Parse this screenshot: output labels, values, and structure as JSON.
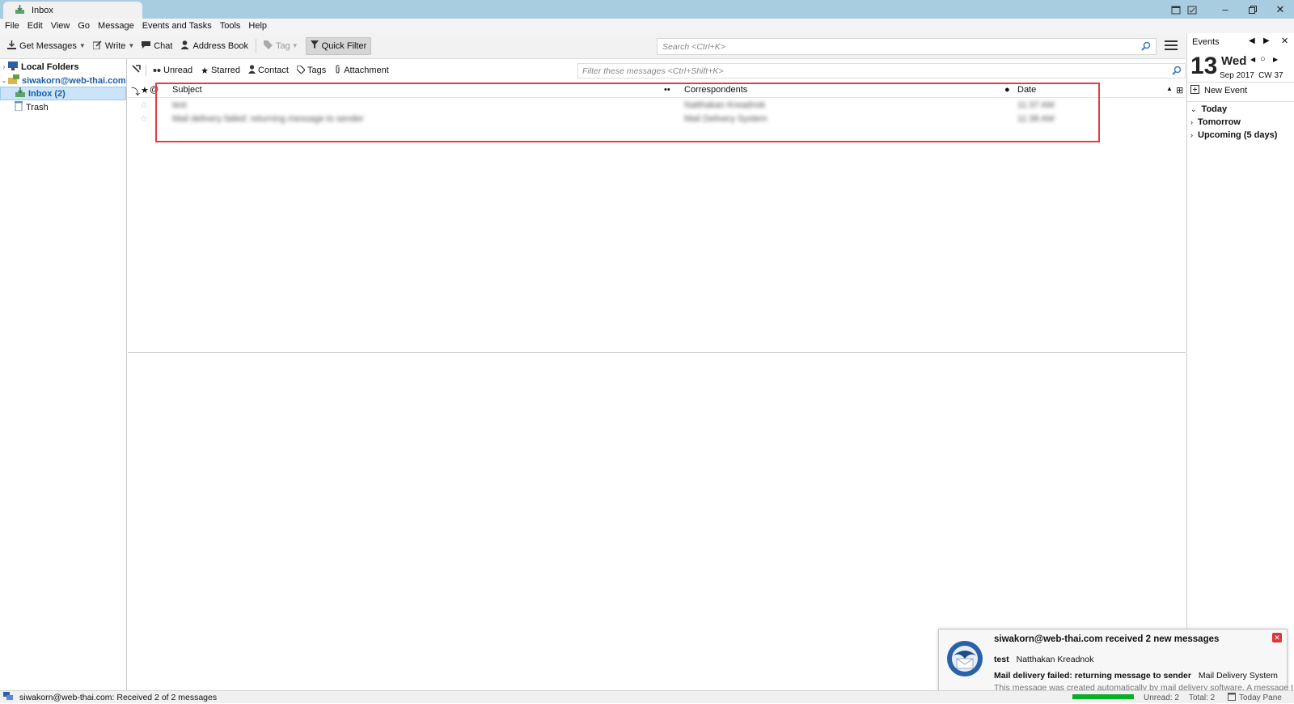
{
  "window": {
    "tab_title": "Inbox",
    "controls": [
      "minimize",
      "restore",
      "close"
    ]
  },
  "menu": {
    "items": [
      "File",
      "Edit",
      "View",
      "Go",
      "Message",
      "Events and Tasks",
      "Tools",
      "Help"
    ]
  },
  "toolbar": {
    "get_messages": "Get Messages",
    "write": "Write",
    "chat": "Chat",
    "address_book": "Address Book",
    "tag": "Tag",
    "quick_filter": "Quick Filter",
    "search_placeholder": "Search <Ctrl+K>"
  },
  "folders": {
    "local_folders": "Local Folders",
    "account": "siwakorn@web-thai.com",
    "inbox": "Inbox (2)",
    "trash": "Trash"
  },
  "quick_filter": {
    "unread": "Unread",
    "starred": "Starred",
    "contact": "Contact",
    "tags": "Tags",
    "attachment": "Attachment",
    "filter_placeholder": "Filter these messages <Ctrl+Shift+K>"
  },
  "thread": {
    "columns": {
      "subject": "Subject",
      "correspondents": "Correspondents",
      "date": "Date"
    },
    "rows": [
      {
        "subject": "test",
        "correspondent": "Natthakan Kreadnok",
        "date": "11:37 AM"
      },
      {
        "subject": "Mail delivery failed: returning message to sender",
        "correspondent": "Mail Delivery System",
        "date": "11:38 AM"
      }
    ]
  },
  "today_pane": {
    "title": "Events",
    "day_number": "13",
    "day_name": "Wed",
    "month_year": "Sep 2017",
    "calendar_week": "CW 37",
    "new_event": "New Event",
    "sections": [
      "Today",
      "Tomorrow",
      "Upcoming (5 days)"
    ]
  },
  "notification": {
    "title": "siwakorn@web-thai.com received 2 new messages",
    "line1_subject": "test",
    "line1_sender": "Natthakan Kreadnok",
    "line2_subject": "Mail delivery failed: returning message to sender",
    "line2_sender": "Mail Delivery System",
    "preview": "This message was created automatically by mail delivery software. A message t..."
  },
  "status": {
    "text": "siwakorn@web-thai.com: Received 2 of 2 messages",
    "unread": "Unread: 2",
    "total": "Total: 2",
    "today_pane": "Today Pane"
  },
  "colors": {
    "titlebar": "#a9cde0",
    "selection": "#cce4f7",
    "highlight_box": "#e63b45",
    "progress": "#06b025"
  }
}
